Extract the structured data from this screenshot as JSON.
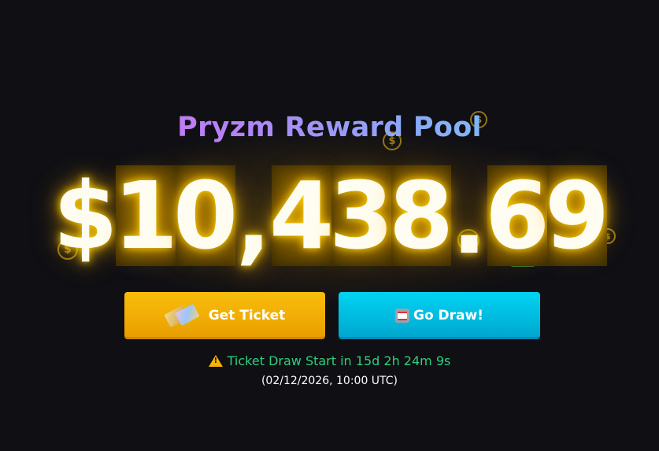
{
  "header": {
    "title": "Pryzm Reward Pool"
  },
  "pool": {
    "amount_chars": [
      "$",
      "1",
      "0",
      ",",
      "4",
      "3",
      "8",
      ".",
      "6",
      "9"
    ],
    "glow_color": "#ffc400",
    "digit_box_color": "#624900"
  },
  "actions": {
    "get_ticket_label": "Get Ticket",
    "get_ticket_icon": "ticket-icon",
    "get_ticket_color": "#f0ab03",
    "go_draw_label": "Go Draw!",
    "go_draw_icon": "slot-machine-icon",
    "go_draw_color": "#00bfe3"
  },
  "status": {
    "warning_icon": "warning-icon",
    "countdown_text": "Ticket Draw Start in 15d 2h 24m 9s",
    "countdown_color": "#2fd07a",
    "draw_date": "(02/12/2026, 10:00 UTC)"
  },
  "decorations": {
    "icons": [
      "dollar-coin-icon",
      "banknote-icon"
    ]
  }
}
